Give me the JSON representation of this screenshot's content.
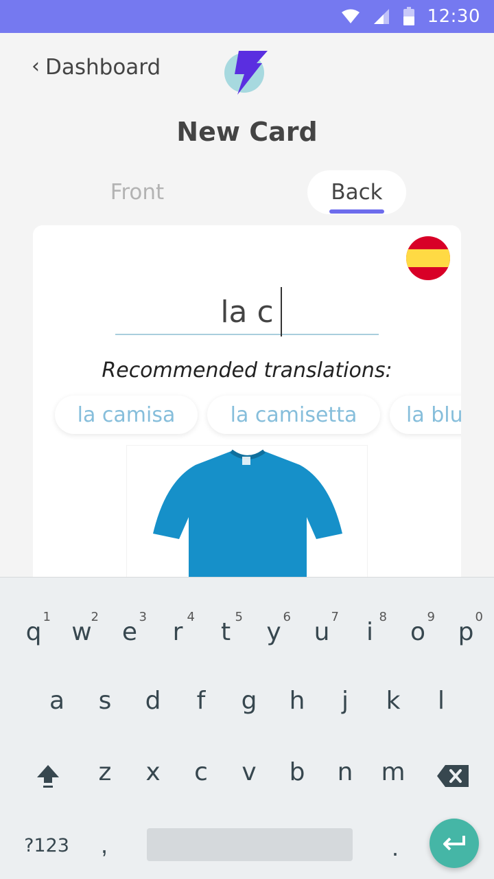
{
  "status_bar": {
    "time": "12:30",
    "icons": [
      "wifi-icon",
      "signal-icon",
      "battery-icon"
    ],
    "color": "#7579f0"
  },
  "header": {
    "back_label": "Dashboard",
    "back_icon": "chevron-left-icon",
    "logo_icon": "lightning-logo-icon"
  },
  "title": "New Card",
  "tabs": [
    {
      "label": "Front",
      "active": false
    },
    {
      "label": "Back",
      "active": true
    }
  ],
  "card": {
    "language_flag": "spain-flag-icon",
    "input_value": "la c",
    "recommended_label": "Recommended translations:",
    "suggestions": [
      "la camisa",
      "la camisetta",
      "la blu"
    ],
    "image": "blue-t-shirt"
  },
  "keyboard": {
    "row1": [
      {
        "key": "q",
        "hint": "1"
      },
      {
        "key": "w",
        "hint": "2"
      },
      {
        "key": "e",
        "hint": "3"
      },
      {
        "key": "r",
        "hint": "4"
      },
      {
        "key": "t",
        "hint": "5"
      },
      {
        "key": "y",
        "hint": "6"
      },
      {
        "key": "u",
        "hint": "7"
      },
      {
        "key": "i",
        "hint": "8"
      },
      {
        "key": "o",
        "hint": "9"
      },
      {
        "key": "p",
        "hint": "0"
      }
    ],
    "row2": [
      "a",
      "s",
      "d",
      "f",
      "g",
      "h",
      "j",
      "k",
      "l"
    ],
    "row3": [
      "z",
      "x",
      "c",
      "v",
      "b",
      "n",
      "m"
    ],
    "symbols_label": "?123",
    "comma": ",",
    "period": "."
  },
  "colors": {
    "accent": "#6d6cec",
    "chip_text": "#86bedb",
    "enter_key": "#45b6a6"
  }
}
